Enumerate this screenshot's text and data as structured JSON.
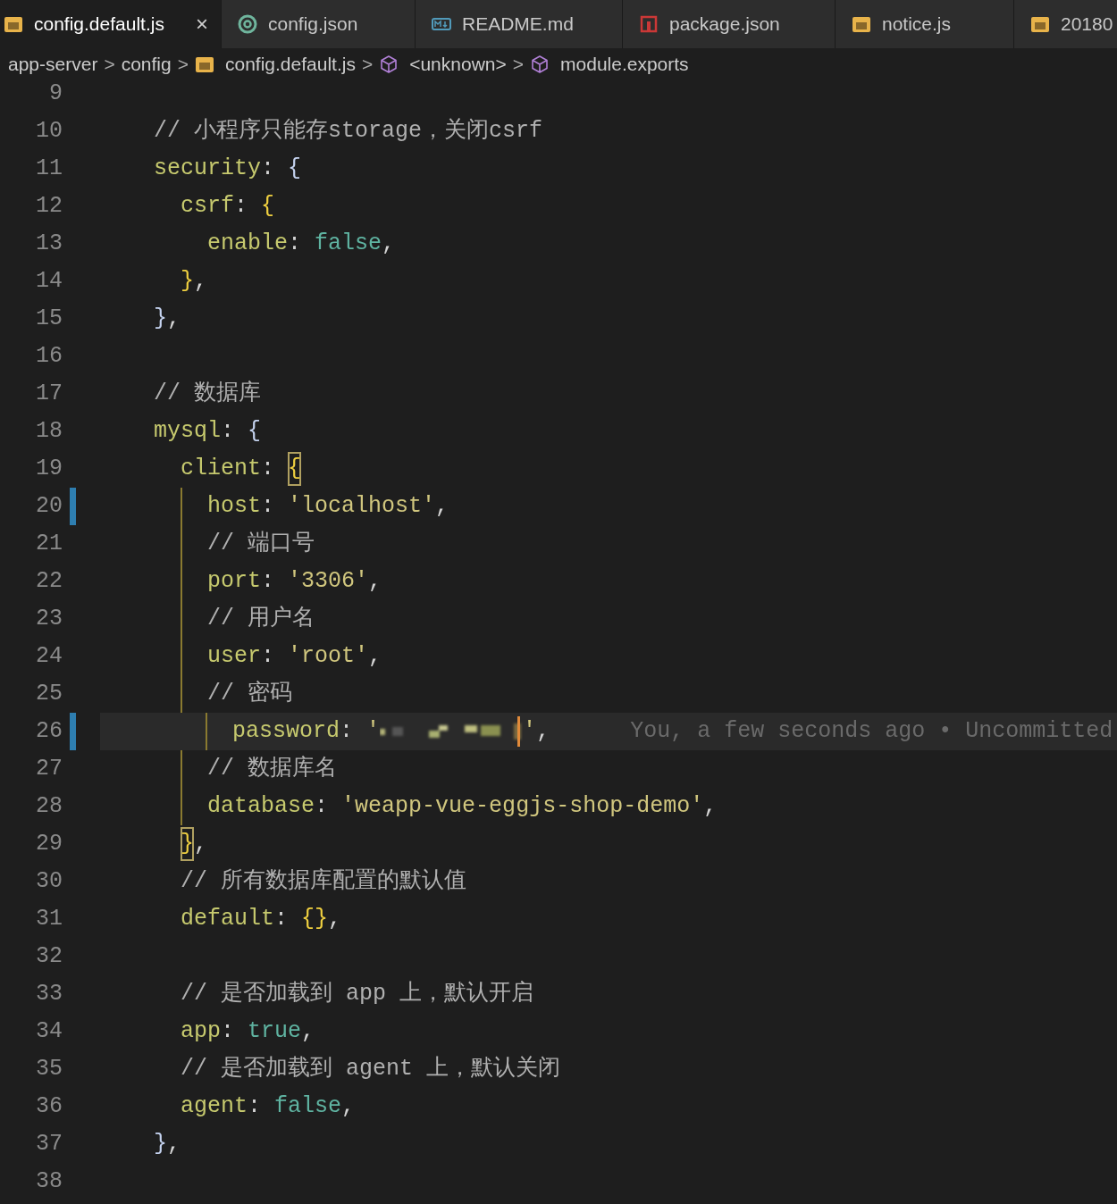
{
  "tabs": [
    {
      "label": "config.default.js",
      "kind": "js",
      "selected": true,
      "close": "×"
    },
    {
      "label": "config.json",
      "kind": "json",
      "selected": false
    },
    {
      "label": "README.md",
      "kind": "md",
      "selected": false
    },
    {
      "label": "package.json",
      "kind": "npm",
      "selected": false
    },
    {
      "label": "notice.js",
      "kind": "js",
      "selected": false
    },
    {
      "label": "20180",
      "kind": "js",
      "selected": false
    }
  ],
  "breadcrumbs": [
    {
      "label": "app-server",
      "kind": "folder"
    },
    {
      "label": "config",
      "kind": "folder"
    },
    {
      "label": "config.default.js",
      "kind": "js"
    },
    {
      "label": "<unknown>",
      "kind": "symbol"
    },
    {
      "label": "module.exports",
      "kind": "symbol"
    }
  ],
  "breadcrumb_separator": ">",
  "editor": {
    "lines": [
      {
        "number": "9"
      },
      {
        "number": "10",
        "tokens": [
          {
            "kind": "comment",
            "s": "    // 小程序只能存storage，关闭csrf"
          }
        ]
      },
      {
        "number": "11",
        "tokens": [
          {
            "kind": "key",
            "s": "    security"
          },
          {
            "kind": "punct",
            "s": ":"
          },
          {
            "kind": "bracket1",
            "s": " {"
          }
        ]
      },
      {
        "number": "12",
        "tokens": [
          {
            "kind": "key",
            "s": "      csrf"
          },
          {
            "kind": "punct",
            "s": ":"
          },
          {
            "kind": "bracket2",
            "s": " {"
          }
        ]
      },
      {
        "number": "13",
        "tokens": [
          {
            "kind": "key",
            "s": "        enable"
          },
          {
            "kind": "punct",
            "s": ":"
          },
          {
            "kind": "literal",
            "s": " false"
          },
          {
            "kind": "punct",
            "s": ","
          }
        ]
      },
      {
        "number": "14",
        "tokens": [
          {
            "kind": "bracket2",
            "s": "      }"
          },
          {
            "kind": "punct",
            "s": ","
          }
        ]
      },
      {
        "number": "15",
        "tokens": [
          {
            "kind": "bracket1",
            "s": "    }"
          },
          {
            "kind": "punct",
            "s": ","
          }
        ]
      },
      {
        "number": "16"
      },
      {
        "number": "17",
        "tokens": [
          {
            "kind": "comment",
            "s": "    // 数据库"
          }
        ]
      },
      {
        "number": "18",
        "tokens": [
          {
            "kind": "key",
            "s": "    mysql"
          },
          {
            "kind": "punct",
            "s": ":"
          },
          {
            "kind": "bracket1",
            "s": " {"
          }
        ]
      },
      {
        "number": "19",
        "tokens": [
          {
            "kind": "key",
            "s": "      client"
          },
          {
            "kind": "punct",
            "s": ":"
          },
          {
            "kind": "bracket2",
            "s": " {",
            "matched": true
          }
        ]
      },
      {
        "number": "20",
        "modified": true,
        "guide": true,
        "tokens": [
          {
            "kind": "key",
            "s": "        host"
          },
          {
            "kind": "punct",
            "s": ":"
          },
          {
            "kind": "string",
            "s": " 'localhost'"
          },
          {
            "kind": "punct",
            "s": ","
          }
        ]
      },
      {
        "number": "21",
        "guide": true,
        "tokens": [
          {
            "kind": "comment",
            "s": "        // 端口号"
          }
        ]
      },
      {
        "number": "22",
        "guide": true,
        "tokens": [
          {
            "kind": "key",
            "s": "        port"
          },
          {
            "kind": "punct",
            "s": ":"
          },
          {
            "kind": "string",
            "s": " '3306'"
          },
          {
            "kind": "punct",
            "s": ","
          }
        ]
      },
      {
        "number": "23",
        "guide": true,
        "tokens": [
          {
            "kind": "comment",
            "s": "        // 用户名"
          }
        ]
      },
      {
        "number": "24",
        "guide": true,
        "tokens": [
          {
            "kind": "key",
            "s": "        user"
          },
          {
            "kind": "punct",
            "s": ":"
          },
          {
            "kind": "string",
            "s": " 'root'"
          },
          {
            "kind": "punct",
            "s": ","
          }
        ]
      },
      {
        "number": "25",
        "guide": true,
        "tokens": [
          {
            "kind": "comment",
            "s": "        // 密码"
          }
        ]
      },
      {
        "number": "26",
        "modified": true,
        "guide": true,
        "current": true,
        "tokens": [
          {
            "kind": "key",
            "s": "        password"
          },
          {
            "kind": "punct",
            "s": ":"
          },
          {
            "kind": "string",
            "s": " '"
          },
          {
            "kind": "redacted"
          },
          {
            "kind": "cursor"
          },
          {
            "kind": "string",
            "s": "'"
          },
          {
            "kind": "punct",
            "s": ","
          }
        ],
        "blame": "You, a few seconds ago • Uncommitted"
      },
      {
        "number": "27",
        "guide": true,
        "tokens": [
          {
            "kind": "comment",
            "s": "        // 数据库名"
          }
        ]
      },
      {
        "number": "28",
        "guide": true,
        "tokens": [
          {
            "kind": "key",
            "s": "        database"
          },
          {
            "kind": "punct",
            "s": ":"
          },
          {
            "kind": "string",
            "s": " 'weapp-vue-eggjs-shop-demo'"
          },
          {
            "kind": "punct",
            "s": ","
          }
        ]
      },
      {
        "number": "29",
        "tokens": [
          {
            "kind": "bracket2",
            "s": "      }",
            "matched": true
          },
          {
            "kind": "punct",
            "s": ","
          }
        ]
      },
      {
        "number": "30",
        "tokens": [
          {
            "kind": "comment",
            "s": "      // 所有数据库配置的默认值"
          }
        ]
      },
      {
        "number": "31",
        "tokens": [
          {
            "kind": "key",
            "s": "      default"
          },
          {
            "kind": "punct",
            "s": ":"
          },
          {
            "kind": "bracket2",
            "s": " {}"
          },
          {
            "kind": "punct",
            "s": ","
          }
        ]
      },
      {
        "number": "32"
      },
      {
        "number": "33",
        "tokens": [
          {
            "kind": "comment",
            "s": "      // 是否加载到 app 上，默认开启"
          }
        ]
      },
      {
        "number": "34",
        "tokens": [
          {
            "kind": "key",
            "s": "      app"
          },
          {
            "kind": "punct",
            "s": ":"
          },
          {
            "kind": "literal",
            "s": " true"
          },
          {
            "kind": "punct",
            "s": ","
          }
        ]
      },
      {
        "number": "35",
        "tokens": [
          {
            "kind": "comment",
            "s": "      // 是否加载到 agent 上，默认关闭"
          }
        ]
      },
      {
        "number": "36",
        "tokens": [
          {
            "kind": "key",
            "s": "      agent"
          },
          {
            "kind": "punct",
            "s": ":"
          },
          {
            "kind": "literal",
            "s": " false"
          },
          {
            "kind": "punct",
            "s": ","
          }
        ]
      },
      {
        "number": "37",
        "tokens": [
          {
            "kind": "bracket1",
            "s": "    }"
          },
          {
            "kind": "punct",
            "s": ","
          }
        ]
      },
      {
        "number": "38"
      }
    ]
  }
}
